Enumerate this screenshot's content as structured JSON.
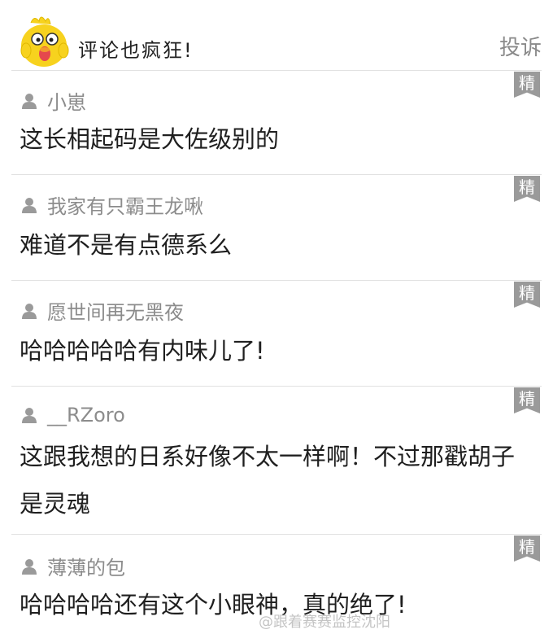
{
  "header": {
    "title": "评论也疯狂!",
    "report_label": "投诉"
  },
  "badge_label": "精",
  "comments": [
    {
      "username": "小崽",
      "text": "这长相起码是大佐级别的"
    },
    {
      "username": "我家有只霸王龙啾",
      "text": "难道不是有点德系么"
    },
    {
      "username": "愿世间再无黑夜",
      "text": "哈哈哈哈哈有内味儿了!"
    },
    {
      "username": "__RZoro",
      "text": "这跟我想的日系好像不太一样啊！不过那戳胡子是灵魂"
    },
    {
      "username": "薄薄的包",
      "text": "哈哈哈哈还有这个小眼神，真的绝了!"
    }
  ],
  "watermark": "@跟着赛赛监控沈阳"
}
